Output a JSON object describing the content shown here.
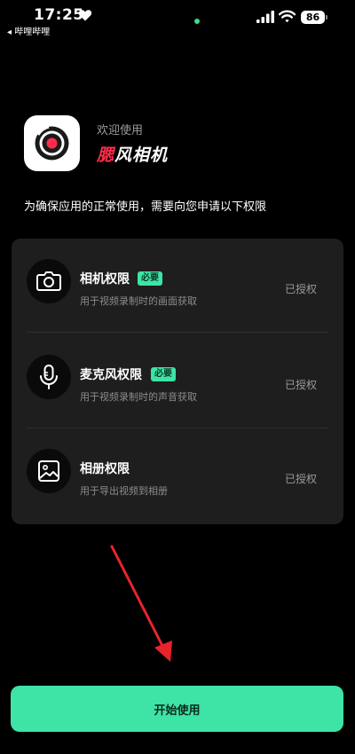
{
  "status_bar": {
    "time": "17:25",
    "back_label": "◂ 哔哩哔哩",
    "battery": "86",
    "indicator_color": "#3ddc84"
  },
  "header": {
    "welcome": "欢迎使用",
    "app_name_accent": "腮",
    "app_name_rest": "风相机"
  },
  "intro": "为确保应用的正常使用，需要向您申请以下权限",
  "permissions": [
    {
      "title": "相机权限",
      "badge": "必要",
      "description": "用于视频录制时的画面获取",
      "status": "已授权",
      "icon": "camera-icon"
    },
    {
      "title": "麦克风权限",
      "badge": "必要",
      "description": "用于视频录制时的声音获取",
      "status": "已授权",
      "icon": "microphone-icon"
    },
    {
      "title": "相册权限",
      "badge": "",
      "description": "用于导出视频到相册",
      "status": "已授权",
      "icon": "photo-album-icon"
    }
  ],
  "start_button": {
    "label": "开始使用"
  },
  "colors": {
    "accent": "#3ee3a6",
    "badge": "#3ee3a6",
    "brand_red": "#ff2d4b",
    "annotation": "#e8242b"
  }
}
